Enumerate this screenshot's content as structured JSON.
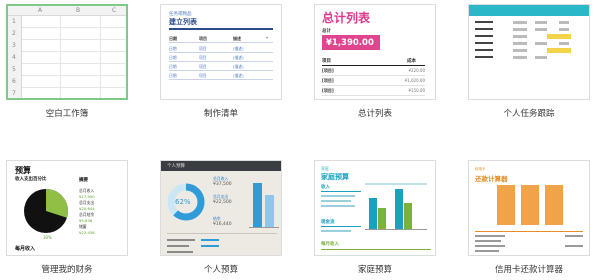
{
  "templates": [
    {
      "caption": "空白工作簿",
      "selected": true,
      "columns": [
        "A",
        "B",
        "C"
      ],
      "rows": [
        "1",
        "2",
        "3",
        "4",
        "5",
        "6",
        "7"
      ]
    },
    {
      "caption": "制作清单",
      "subtitle": "任务或物品",
      "title": "建立列表",
      "headers": [
        "日期",
        "项目",
        "描述"
      ],
      "rows": [
        [
          "日期",
          "项目",
          "(描述)"
        ],
        [
          "日期",
          "项目",
          "(描述)"
        ],
        [
          "日期",
          "项目",
          "(描述)"
        ],
        [
          "日期",
          "项目",
          "(描述)"
        ]
      ]
    },
    {
      "caption": "总计列表",
      "title": "总计列表",
      "total_label": "总计",
      "total_value": "¥1,390.00",
      "col_item": "项目",
      "col_amount": "成本",
      "rows": [
        [
          "[项目]",
          "¥220.00"
        ],
        [
          "[项目]",
          "¥1,020.00"
        ],
        [
          "[项目]",
          "¥150.00"
        ]
      ]
    },
    {
      "caption": "个人任务跟踪"
    },
    {
      "caption": "管理我的财务",
      "title": "预算",
      "pie_title": "收入支出百分比",
      "summary_title": "摘要",
      "summary_lines": [
        "总月收入",
        "¥17,500",
        "总月支出",
        "¥20,644",
        "总月结余",
        "¥5,836",
        "储蓄",
        "¥22,436"
      ],
      "pie_percent": "30%",
      "bottom_title": "每月收入",
      "pie_share": 0.3
    },
    {
      "caption": "个人预算",
      "header": "个人预算",
      "donut_percent": "62%",
      "donut_share": 0.62,
      "figures": [
        "¥37,500",
        "¥22,500",
        "¥16,440"
      ],
      "figure_labels": [
        "总月收入",
        "总月支出",
        "结余"
      ]
    },
    {
      "caption": "家庭预算",
      "subtitle": "家庭",
      "title": "家庭预算",
      "section1": "收入",
      "section2": "现金流",
      "section3": "每月收入"
    },
    {
      "caption": "信用卡还款计算器",
      "subtitle": "信用卡",
      "title": "还款计算器"
    }
  ]
}
